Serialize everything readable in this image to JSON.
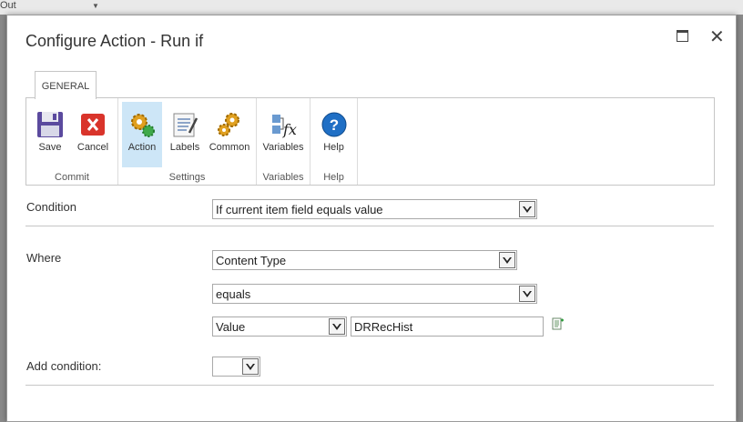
{
  "background": {
    "partial_text": "Out"
  },
  "dialog": {
    "title": "Configure Action - Run if",
    "maximize_label": "maximize",
    "close_label": "close"
  },
  "ribbon": {
    "tab": "GENERAL",
    "groups": {
      "commit": {
        "label": "Commit",
        "save": "Save",
        "cancel": "Cancel"
      },
      "settings": {
        "label": "Settings",
        "action": "Action",
        "labels": "Labels",
        "common": "Common"
      },
      "variables": {
        "label": "Variables",
        "variables": "Variables"
      },
      "help": {
        "label": "Help",
        "help": "Help"
      }
    }
  },
  "form": {
    "condition": {
      "label": "Condition",
      "value": "If current item field equals value"
    },
    "where": {
      "label": "Where",
      "field": "Content Type",
      "operator": "equals",
      "value_type": "Value",
      "value": "DRRecHist"
    },
    "add_condition": {
      "label": "Add condition:",
      "value": ""
    }
  },
  "colors": {
    "active_button": "#cde6f7",
    "divider": "#c6c6c6"
  }
}
